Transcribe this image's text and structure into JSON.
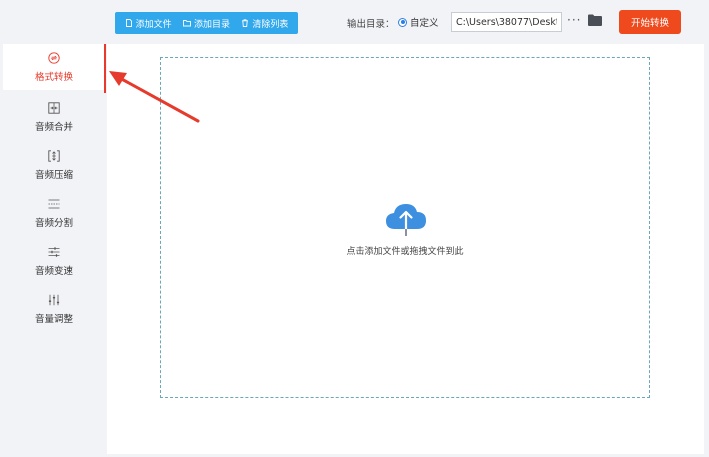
{
  "toolbar": {
    "add_file_label": "添加文件",
    "add_dir_label": "添加目录",
    "clear_list_label": "清除列表",
    "output_dir_label": "输出目录：",
    "custom_option_label": "自定义",
    "output_path_value": "C:\\Users\\38077\\Desktc",
    "more_label": "···",
    "start_label": "开始转换",
    "accent_color": "#31a7ec",
    "start_color": "#ee4a1d"
  },
  "sidebar": {
    "items": [
      {
        "label": "格式转换",
        "icon": "format-convert-icon",
        "active": true
      },
      {
        "label": "音频合并",
        "icon": "merge-icon"
      },
      {
        "label": "音频压缩",
        "icon": "compress-icon"
      },
      {
        "label": "音频分割",
        "icon": "split-icon"
      },
      {
        "label": "音频变速",
        "icon": "speed-icon"
      },
      {
        "label": "音量调整",
        "icon": "volume-icon"
      }
    ],
    "active_color": "#e8392c"
  },
  "dropzone": {
    "hint": "点击添加文件或拖拽文件到此",
    "icon": "cloud-upload-icon"
  }
}
